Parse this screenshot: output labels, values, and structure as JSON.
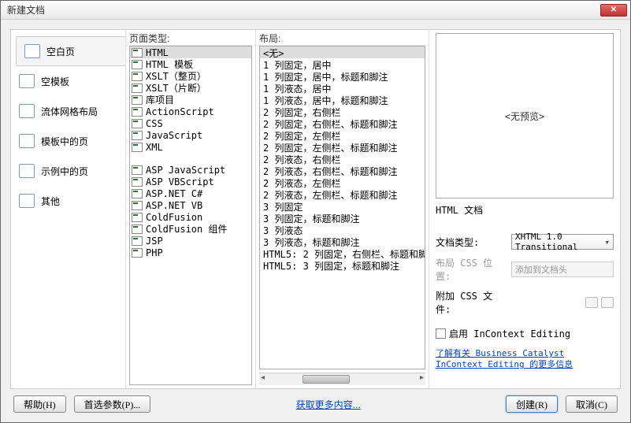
{
  "title": "新建文档",
  "sidebar": {
    "items": [
      {
        "label": "空白页"
      },
      {
        "label": "空模板"
      },
      {
        "label": "流体网格布局"
      },
      {
        "label": "模板中的页"
      },
      {
        "label": "示例中的页"
      },
      {
        "label": "其他"
      }
    ]
  },
  "columns": {
    "page_type_header": "页面类型:",
    "layout_header": "布局:"
  },
  "page_types_a": [
    "HTML",
    "HTML 模板",
    "XSLT（整页）",
    "XSLT（片断）",
    "库项目",
    "ActionScript",
    "CSS",
    "JavaScript",
    "XML"
  ],
  "page_types_b": [
    "ASP JavaScript",
    "ASP VBScript",
    "ASP.NET C#",
    "ASP.NET VB",
    "ColdFusion",
    "ColdFusion 组件",
    "JSP",
    "PHP"
  ],
  "layouts": [
    "<无>",
    "1 列固定，居中",
    "1 列固定，居中，标题和脚注",
    "1 列液态，居中",
    "1 列液态，居中，标题和脚注",
    "2 列固定，右侧栏",
    "2 列固定，右侧栏、标题和脚注",
    "2 列固定，左侧栏",
    "2 列固定，左侧栏、标题和脚注",
    "2 列液态，右侧栏",
    "2 列液态，右侧栏、标题和脚注",
    "2 列液态，左侧栏",
    "2 列液态，左侧栏、标题和脚注",
    "3 列固定",
    "3 列固定，标题和脚注",
    "3 列液态",
    "3 列液态，标题和脚注",
    "HTML5: 2 列固定，右侧栏、标题和脚",
    "HTML5: 3 列固定，标题和脚注"
  ],
  "right": {
    "preview_text": "<无预览>",
    "preview_caption": "HTML 文档",
    "doctype_label": "文档类型:",
    "doctype_value": "XHTML 1.0 Transitional",
    "layout_css_label": "布局 CSS 位置:",
    "layout_css_value": "添加到文档头",
    "attach_css_label": "附加 CSS 文件:",
    "enable_ice_label": "启用 InContext Editing",
    "ice_link": "了解有关 Business Catalyst InContext Editing 的更多信息"
  },
  "buttons": {
    "help": "帮助(H)",
    "prefs": "首选参数(P)...",
    "more": "获取更多内容...",
    "create": "创建(R)",
    "cancel": "取消(C)"
  }
}
